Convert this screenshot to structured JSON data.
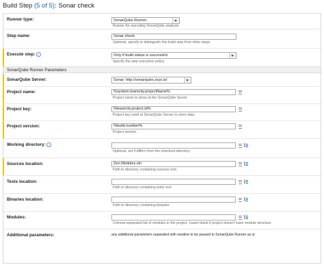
{
  "header": {
    "title_prefix": "Build Step ",
    "step_indicator": "(5 of 5)",
    "title_suffix": ": Sonar check"
  },
  "fields": {
    "runner_type": {
      "label": "Runner type:",
      "value": "SonarQube Runner",
      "note": "Runner for executing SonarQube analysis"
    },
    "step_name": {
      "label": "Step name:",
      "value": "Sonar check",
      "note": "Optional, specify to distinguish this build step from other steps."
    },
    "execute_step": {
      "label": "Execute step:",
      "value": "Only if build status is successful",
      "note": "Specify the step execution policy."
    },
    "section_title": "SonarQube Runner Parameters",
    "sonarqube_server": {
      "label": "SonarQube Server:",
      "value": "Sonar: http://sonarqube.zsys.io/"
    },
    "project_name": {
      "label": "Project name:",
      "value": "%system.teamcity.projectName%",
      "note": "Project name to show at the SonarQube Server"
    },
    "project_key": {
      "label": "Project key:",
      "value": "%teamcity.project.id%",
      "note": "Project key used at SonarQube Server to store data"
    },
    "project_version": {
      "label": "Project version:",
      "value": "%build.number%",
      "note": "Project version."
    },
    "working_directory": {
      "label": "Working directory:",
      "value": "",
      "note": "Optional, set if differs from the checkout directory."
    },
    "sources_location": {
      "label": "Sources location:",
      "value": "Zen.Modules.sln",
      "note": "Path to directory containing sources root."
    },
    "tests_location": {
      "label": "Tests location:",
      "value": "",
      "note": "Path to directory containing tests root"
    },
    "binaries_location": {
      "label": "Binaries location:",
      "value": "",
      "note": "Path to directory containing binaries"
    },
    "modules": {
      "label": "Modules:",
      "value": "",
      "note": "Comma-separated list of modules in the project. Leave blank if project doesn't have module structure."
    },
    "additional_parameters": {
      "label": "Additional parameters:",
      "note": "any additional parameters separated with newline to be passed to SonarQube Runner as is:"
    }
  },
  "help_icon_glyph": "?",
  "colors": {
    "accent": "#f2c200",
    "link": "#1a5fb4"
  }
}
